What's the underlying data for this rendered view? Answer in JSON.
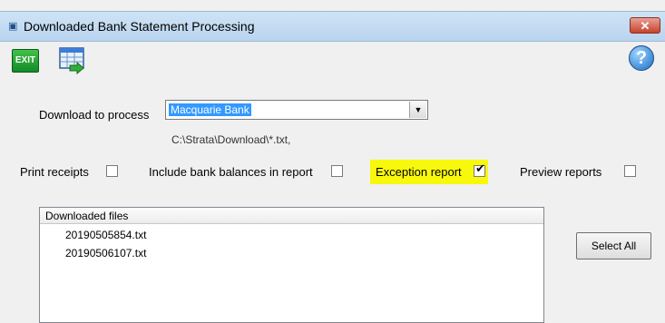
{
  "window": {
    "title": "Downloaded Bank Statement Processing",
    "close_glyph": "✕"
  },
  "toolbar": {
    "exit_label": "EXIT",
    "grid_icon": "grid-export-icon",
    "help_glyph": "?"
  },
  "download": {
    "label": "Download to process",
    "selected": "Macquarie Bank",
    "path": "C:\\Strata\\Download\\*.txt,"
  },
  "options": {
    "print_receipts": {
      "label": "Print receipts",
      "checked": false
    },
    "include_bank_balances": {
      "label": "Include bank balances in report",
      "checked": false
    },
    "exception_report": {
      "label": "Exception report",
      "checked": true
    },
    "preview_reports": {
      "label": "Preview reports",
      "checked": false
    }
  },
  "files": {
    "header": "Downloaded files",
    "items": [
      "20190505854.txt",
      "20190506107.txt"
    ]
  },
  "buttons": {
    "select_all": "Select All"
  },
  "colors": {
    "highlight": "#f8f80d",
    "selection": "#3399ff",
    "titlebar": "#b9d4ef",
    "close": "#c7432b"
  }
}
